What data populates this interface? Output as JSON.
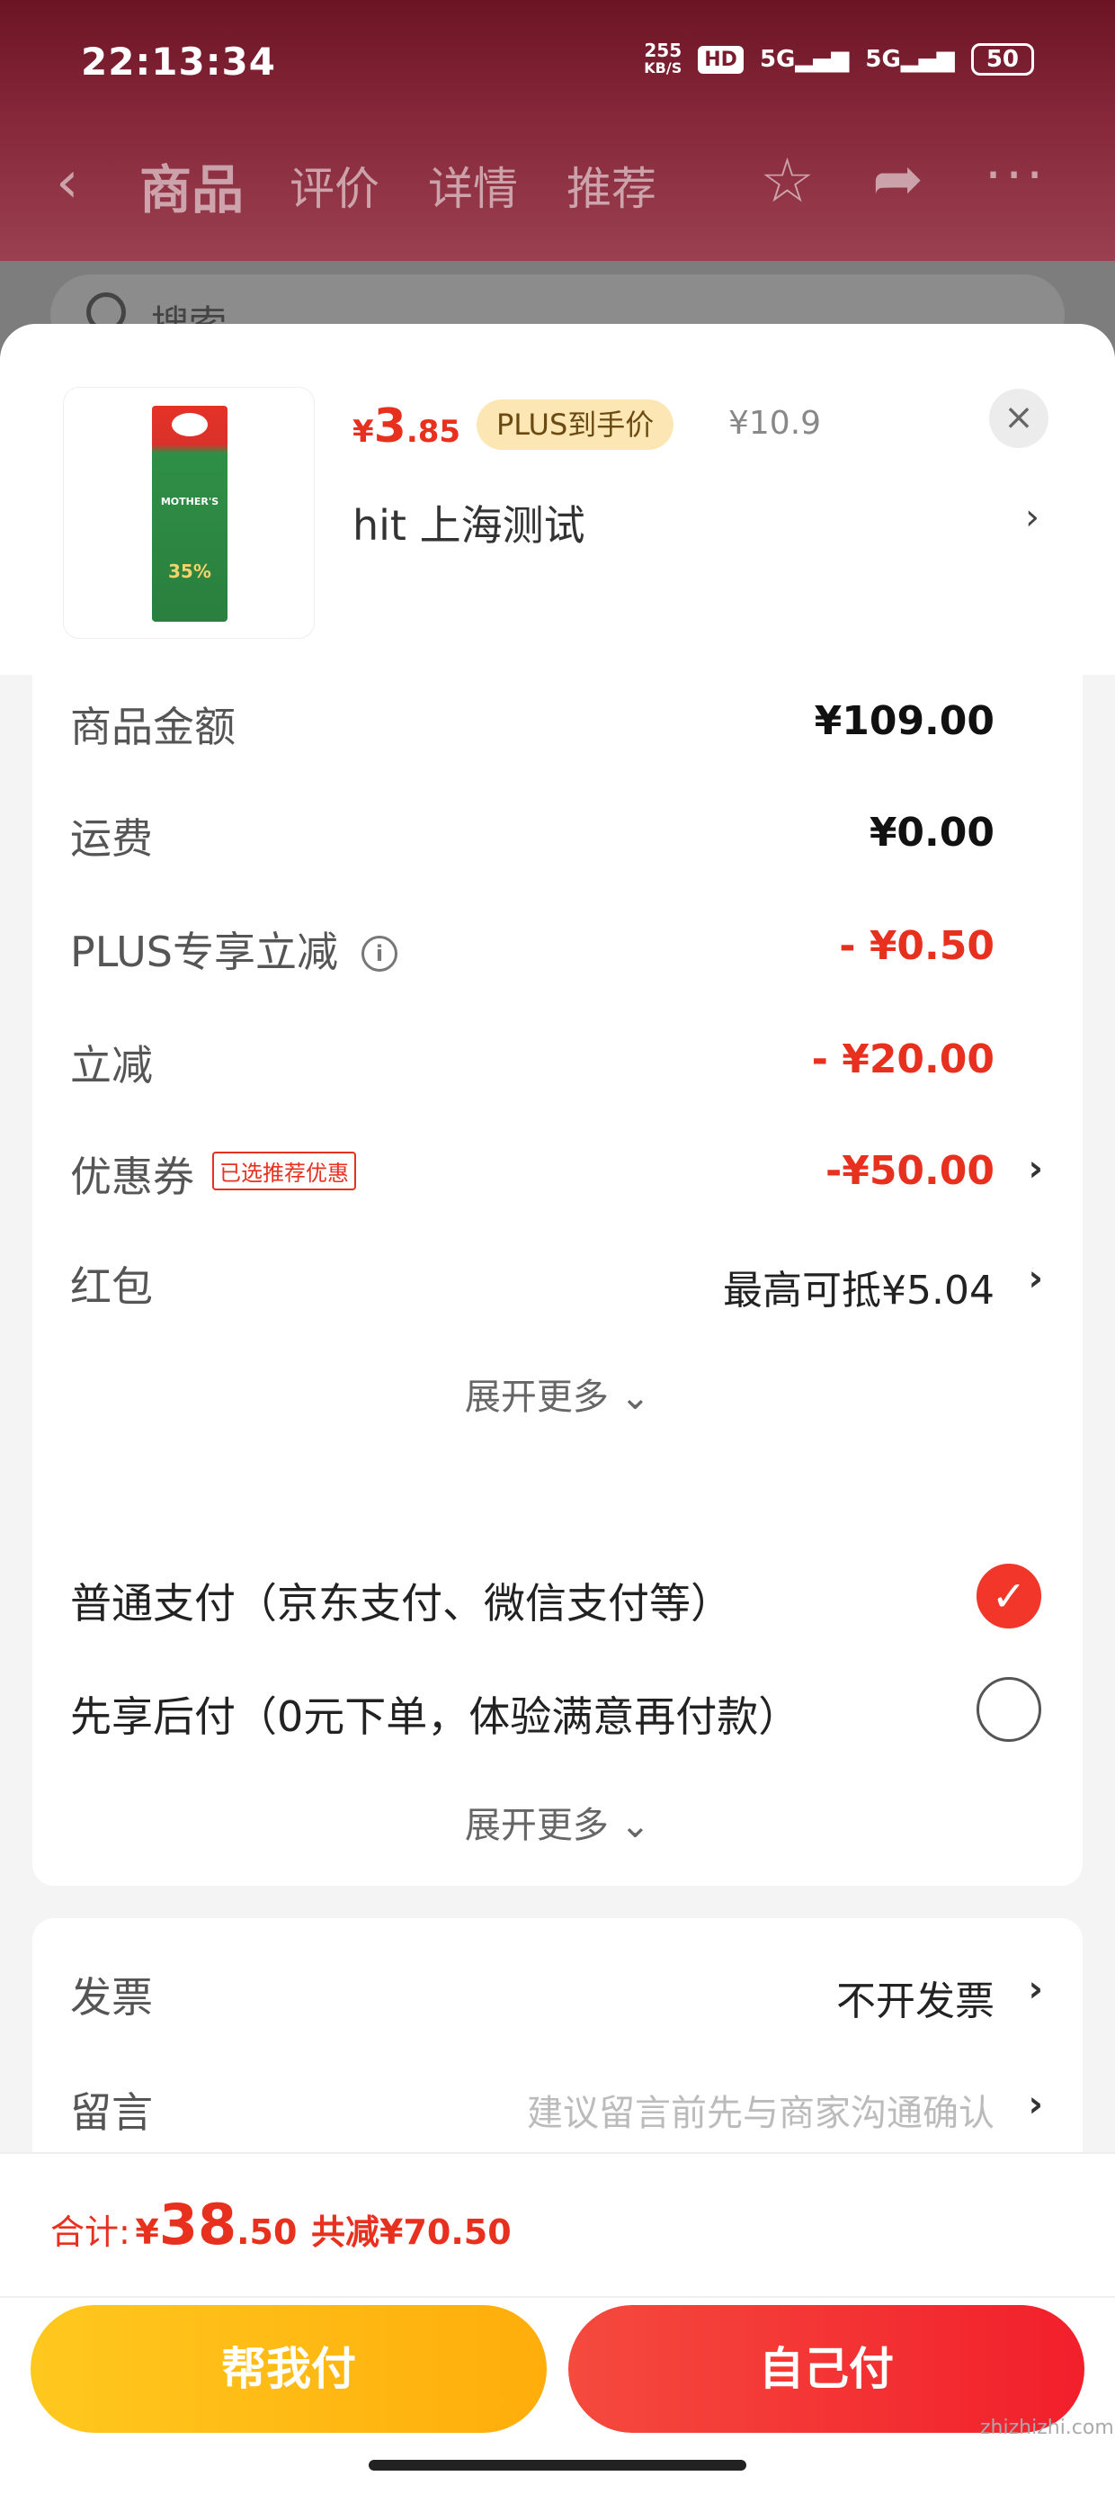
{
  "status": {
    "time": "22:13:34",
    "speed_top": "255",
    "speed_unit": "KB/S",
    "hd": "HD",
    "signal1": "5G",
    "signal2": "5G",
    "battery": "50"
  },
  "background_nav": {
    "tabs": [
      "商品",
      "评价",
      "详情",
      "推荐"
    ],
    "search_placeholder": "搜索"
  },
  "product": {
    "price_symbol": "¥",
    "price_int": "3",
    "price_dec": ".85",
    "plus_tag": "PLUS到手价",
    "original_price": "¥10.9",
    "address": "hit  上海测试",
    "pack_brand": "MOTHER'S",
    "pack_pct": "35%"
  },
  "fees": [
    {
      "label": "商品金额",
      "value": "¥109.00"
    },
    {
      "label": "运费",
      "value": "¥0.00"
    },
    {
      "label": "PLUS专享立减",
      "value": "- ¥0.50"
    },
    {
      "label": "立减",
      "value": "- ¥20.00"
    },
    {
      "label": "优惠券",
      "tag": "已选推荐优惠",
      "value": "-¥50.00"
    },
    {
      "label": "红包",
      "value": "最高可抵¥5.04"
    }
  ],
  "expand_more": "展开更多",
  "payment": {
    "options": [
      {
        "label": "普通支付（京东支付、微信支付等）",
        "selected": true
      },
      {
        "label": "先享后付（0元下单，体验满意再付款）",
        "selected": false
      }
    ],
    "expand_more": "展开更多"
  },
  "invoice": {
    "label": "发票",
    "value": "不开发票"
  },
  "message": {
    "label": "留言",
    "placeholder": "建议留言前先与商家沟通确认"
  },
  "total": {
    "label": "合计:",
    "symbol": "¥",
    "int": "38",
    "dec": ".50",
    "saved": "共减¥70.50"
  },
  "buttons": {
    "help_pay": "帮我付",
    "self_pay": "自己付"
  },
  "watermark": "zhizhizhi.com",
  "colors": {
    "accent_red": "#e8301f",
    "plus_tag_bg": "#fbe6b4",
    "help_btn": "#ffb812",
    "self_btn": "#f2362a"
  }
}
